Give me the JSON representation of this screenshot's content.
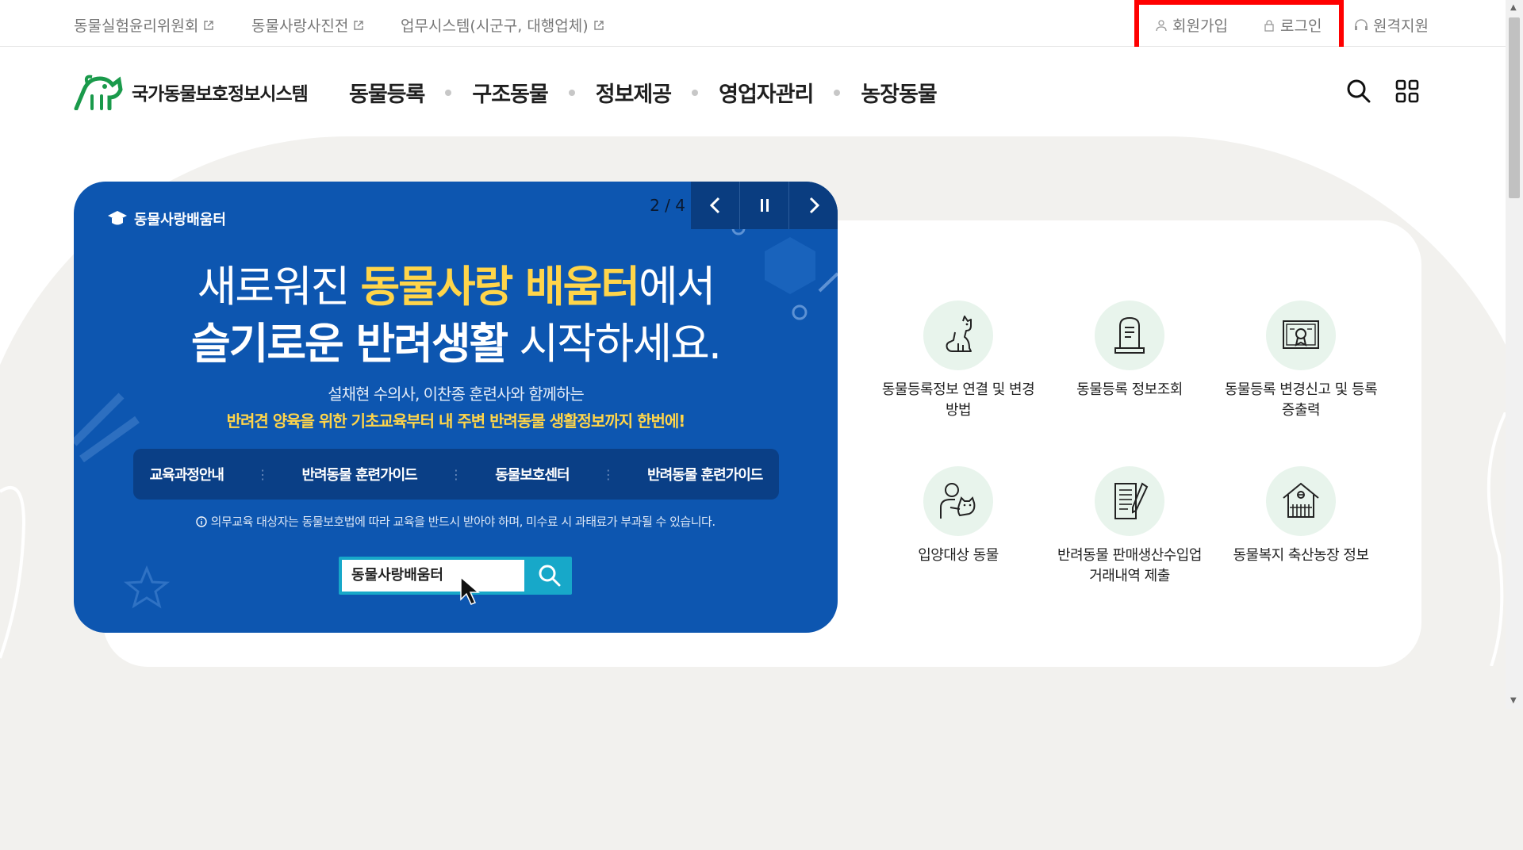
{
  "utility_bar": {
    "links": [
      {
        "label": "동물실험윤리위원회"
      },
      {
        "label": "동물사랑사진전"
      },
      {
        "label": "업무시스템(시군구, 대행업체)"
      }
    ],
    "signup": "회원가입",
    "login": "로그인",
    "remote_support": "원격지원"
  },
  "header": {
    "logo_text": "국가동물보호정보시스템",
    "nav": [
      "동물등록",
      "구조동물",
      "정보제공",
      "영업자관리",
      "농장동물"
    ],
    "icons": {
      "search": "search-icon",
      "menu": "grid-menu-icon"
    }
  },
  "banner": {
    "counter": "2 / 4",
    "brand": "동물사랑배움터",
    "line1_pre": "새로워진 ",
    "line1_highlight": "동물사랑 배움터",
    "line1_post": "에서",
    "line2_bold": "슬기로운 반려생활",
    "line2_post": " 시작하세요.",
    "sub1": "설채현 수의사, 이찬종 훈련사와 함께하는",
    "sub2": "반려견 양육을 위한 기초교육부터 내 주변 반려동물 생활정보까지 한번에!",
    "menu": [
      "교육과정안내",
      "반려동물 훈련가이드",
      "동물보호센터",
      "반려동물 훈련가이드"
    ],
    "notice": "의무교육 대상자는 동물보호법에 따라 교육을 반드시 받아야 하며, 미수료 시 과태료가 부과될 수 있습니다.",
    "search_text": "동물사랑배움터",
    "highlight_color": "#ffd54a",
    "bg_color": "#0d56b0"
  },
  "quick_links": [
    {
      "label": "동물등록정보 연결 및 변경방법",
      "icon": "dog-sitting-icon"
    },
    {
      "label": "동물등록 정보조회",
      "icon": "tombstone-icon"
    },
    {
      "label": "동물등록 변경신고 및 등록증출력",
      "icon": "certificate-icon"
    },
    {
      "label": "입양대상 동물",
      "icon": "person-with-dog-icon"
    },
    {
      "label": "반려동물 판매생산수입업 거래내역 제출",
      "icon": "document-pen-icon"
    },
    {
      "label": "동물복지 축산농장 정보",
      "icon": "barn-icon"
    }
  ],
  "colors": {
    "brand_green": "#1a9a4b",
    "highlight_box": "#ff0000"
  }
}
